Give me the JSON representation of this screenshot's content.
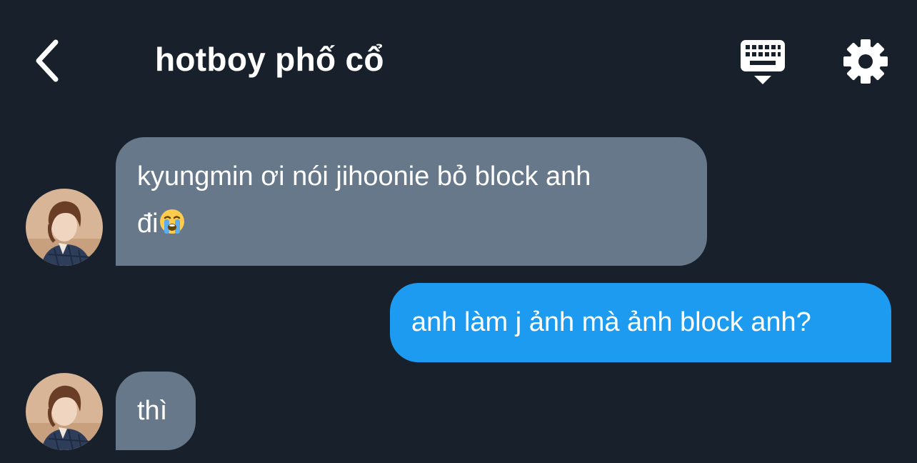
{
  "header": {
    "title": "hotboy phố cổ",
    "back_icon": "chevron-left-icon",
    "keyboard_icon": "keyboard-icon",
    "settings_icon": "gear-icon"
  },
  "messages": [
    {
      "direction": "incoming",
      "text_line1": "kyungmin ơi nói jihoonie bỏ block anh",
      "text_line2": "đi",
      "emoji": "loudly-crying-face-emoji"
    },
    {
      "direction": "outgoing",
      "text": "anh làm j ảnh mà ảnh block anh?"
    },
    {
      "direction": "incoming",
      "text": "thì"
    }
  ],
  "colors": {
    "background": "#17202b",
    "incoming_bubble": "#66788a",
    "outgoing_bubble": "#1d9bf0",
    "text": "#ffffff"
  }
}
